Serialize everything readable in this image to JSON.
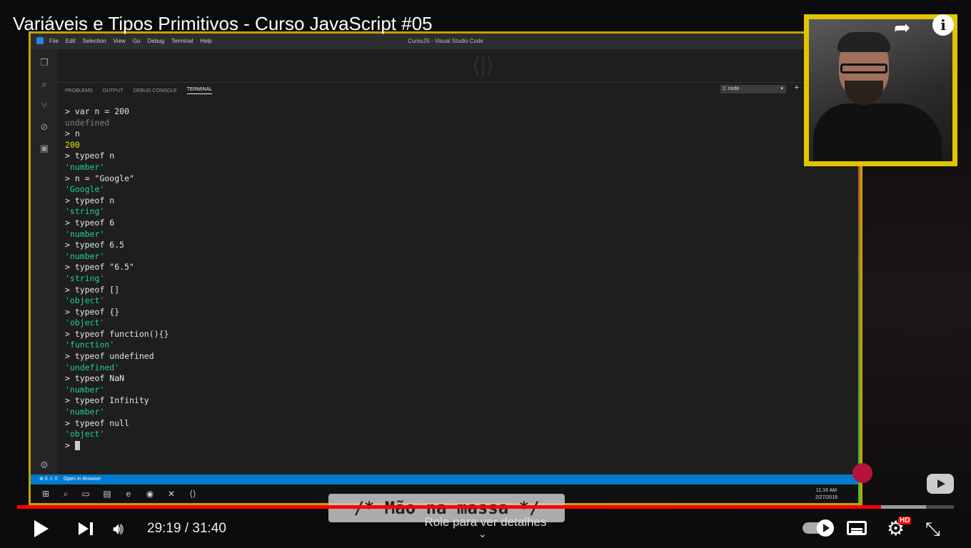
{
  "video": {
    "title": "Variáveis e Tipos Primitivos - Curso JavaScript #05",
    "time_display": "29:19 / 31:40",
    "progress_fraction": 0.922,
    "buffer_fraction": 0.97,
    "scroll_hint": "Role para ver detalhes",
    "caption_banner": "/* Mão na massa */",
    "hd_badge": "HD"
  },
  "vscode": {
    "menu": [
      "File",
      "Edit",
      "Selection",
      "View",
      "Go",
      "Debug",
      "Terminal",
      "Help"
    ],
    "window_title": "CursoJS - Visual Studio Code",
    "panel_tabs": [
      "PROBLEMS",
      "OUTPUT",
      "DEBUG CONSOLE",
      "TERMINAL"
    ],
    "active_tab": "TERMINAL",
    "terminal_select": "1: node",
    "status_left": "⊗ 0 ⚠ 0",
    "status_browser": "Open In Browser",
    "clock_time": "11:16 AM",
    "clock_date": "2/27/2019"
  },
  "terminal_lines": [
    {
      "text": "> var n = 200",
      "kind": "cmd"
    },
    {
      "text": "undefined",
      "kind": "out-gray"
    },
    {
      "text": "> n",
      "kind": "cmd"
    },
    {
      "text": "200",
      "kind": "out-yellow"
    },
    {
      "text": "> typeof n",
      "kind": "cmd"
    },
    {
      "text": "'number'",
      "kind": "out-green"
    },
    {
      "text": "> n = \"Google\"",
      "kind": "cmd"
    },
    {
      "text": "'Google'",
      "kind": "out-green"
    },
    {
      "text": "> typeof n",
      "kind": "cmd"
    },
    {
      "text": "'string'",
      "kind": "out-green"
    },
    {
      "text": "> typeof 6",
      "kind": "cmd"
    },
    {
      "text": "'number'",
      "kind": "out-green"
    },
    {
      "text": "> typeof 6.5",
      "kind": "cmd"
    },
    {
      "text": "'number'",
      "kind": "out-green"
    },
    {
      "text": "> typeof \"6.5\"",
      "kind": "cmd"
    },
    {
      "text": "'string'",
      "kind": "out-green"
    },
    {
      "text": "> typeof []",
      "kind": "cmd"
    },
    {
      "text": "'object'",
      "kind": "out-green"
    },
    {
      "text": "> typeof {}",
      "kind": "cmd"
    },
    {
      "text": "'object'",
      "kind": "out-green"
    },
    {
      "text": "> typeof function(){}",
      "kind": "cmd"
    },
    {
      "text": "'function'",
      "kind": "out-green"
    },
    {
      "text": "> typeof undefined",
      "kind": "cmd"
    },
    {
      "text": "'undefined'",
      "kind": "out-green"
    },
    {
      "text": "> typeof NaN",
      "kind": "cmd"
    },
    {
      "text": "'number'",
      "kind": "out-green"
    },
    {
      "text": "> typeof Infinity",
      "kind": "cmd"
    },
    {
      "text": "'number'",
      "kind": "out-green"
    },
    {
      "text": "> typeof null",
      "kind": "cmd"
    },
    {
      "text": "'object'",
      "kind": "out-green"
    }
  ],
  "terminal_prompt": ">",
  "icons": {
    "share": "share-icon",
    "info": "info-icon",
    "play": "play-icon",
    "next": "next-icon",
    "volume": "volume-icon",
    "autoplay": "autoplay-toggle",
    "captions": "captions-icon",
    "settings": "gear-icon",
    "fullscreen": "exit-fullscreen-icon"
  },
  "colors": {
    "progress": "#ff0000",
    "webcam_frame": "#e2c400",
    "terminal_green": "#23d18b",
    "terminal_yellow": "#e5e510",
    "status_blue": "#007acc"
  }
}
